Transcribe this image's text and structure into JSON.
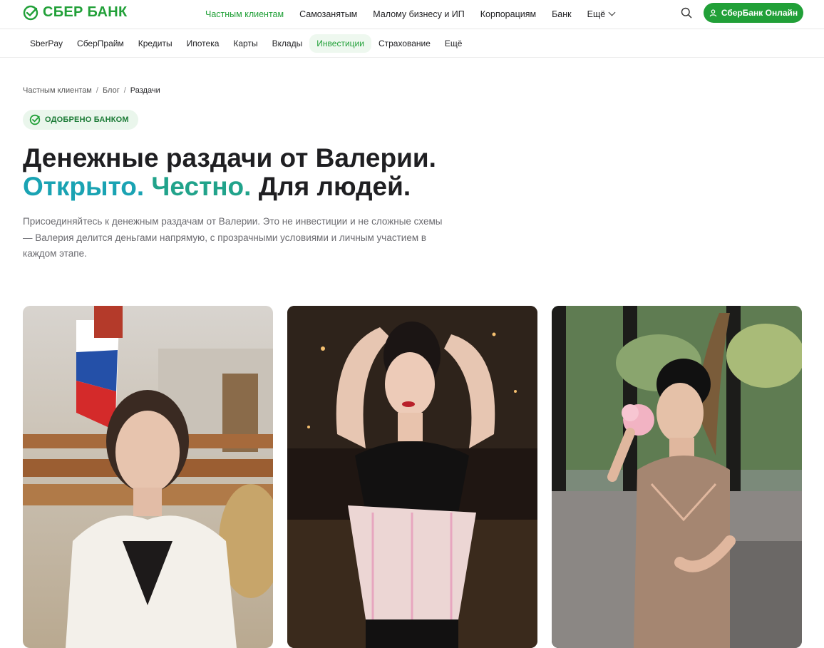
{
  "brand": {
    "name": "СБЕР БАНК",
    "color": "#21a038"
  },
  "header": {
    "nav": [
      {
        "label": "Частным клиентам",
        "active": true
      },
      {
        "label": "Самозанятым",
        "active": false
      },
      {
        "label": "Малому бизнесу и ИП",
        "active": false
      },
      {
        "label": "Корпорациям",
        "active": false
      },
      {
        "label": "Банк",
        "active": false
      }
    ],
    "more_label": "Ещё",
    "online_button": "СберБанк Онлайн",
    "search_icon": "search-icon"
  },
  "subnav": {
    "items": [
      {
        "label": "SberPay",
        "active": false
      },
      {
        "label": "СберПрайм",
        "active": false
      },
      {
        "label": "Кредиты",
        "active": false
      },
      {
        "label": "Ипотека",
        "active": false
      },
      {
        "label": "Карты",
        "active": false
      },
      {
        "label": "Вклады",
        "active": false
      },
      {
        "label": "Инвестиции",
        "active": true
      },
      {
        "label": "Страхование",
        "active": false
      },
      {
        "label": "Ещё",
        "active": false
      }
    ]
  },
  "breadcrumb": [
    "Частным клиентам",
    "Блог",
    "Раздачи"
  ],
  "badge": "ОДОБРЕНО БАНКОМ",
  "title": {
    "line1": "Денежные раздачи от Валерии.",
    "part_a": "Открыто.",
    "part_b": "Честно.",
    "part_c": "Для людей."
  },
  "lead": "Присоединяйтесь к денежным раздачам от Валерии. Это не инвестиции и не сложные схемы — Валерия делится деньгами напрямую, с прозрачными условиями и личным участием в каждом этапе.",
  "colors": {
    "accent": "#21a038",
    "teal": "#1aa3b3",
    "teal_green": "#21a38b"
  },
  "cards": [
    "photo-official-hall",
    "photo-night-corset",
    "photo-cafe-flower"
  ]
}
